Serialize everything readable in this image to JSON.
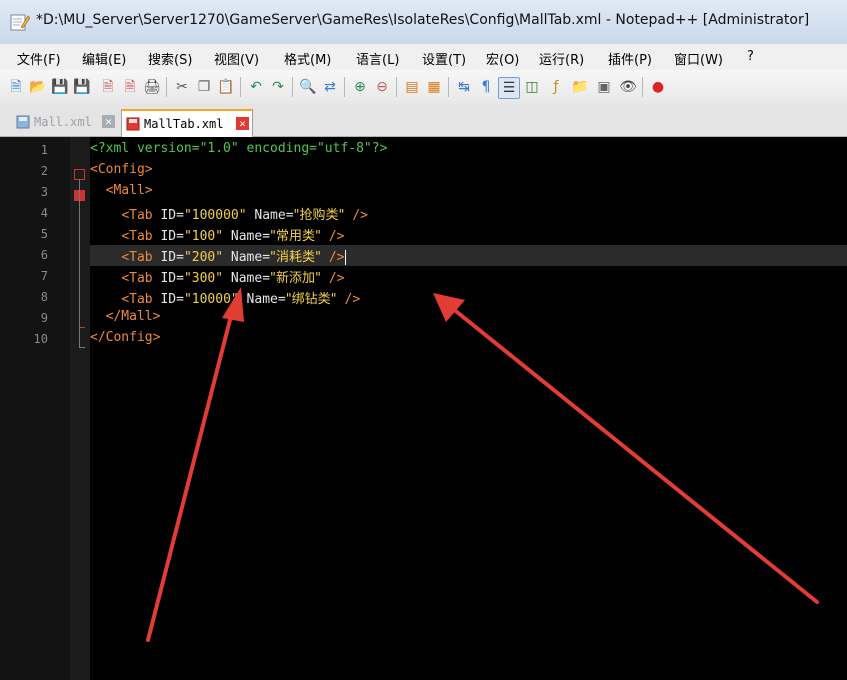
{
  "window": {
    "title": "*D:\\MU_Server\\Server1270\\GameServer\\GameRes\\IsolateRes\\Config\\MallTab.xml - Notepad++ [Administrator]"
  },
  "menu": [
    "文件(F)",
    "编辑(E)",
    "搜索(S)",
    "视图(V)",
    "格式(M)",
    "语言(L)",
    "设置(T)",
    "宏(O)",
    "运行(R)",
    "插件(P)",
    "窗口(W)",
    "?"
  ],
  "tabs": [
    {
      "label": "Mall.xml"
    },
    {
      "label": "MallTab.xml"
    }
  ],
  "line_numbers": [
    "1",
    "2",
    "3",
    "4",
    "5",
    "6",
    "7",
    "8",
    "9",
    "10"
  ],
  "code": {
    "l1": "<?xml version=\"1.0\" encoding=\"utf-8\"?>",
    "l2": "<Config>",
    "l3": "<Mall>",
    "tab_open": "<Tab",
    "id_attr": " ID=",
    "name_attr": " Name=",
    "tab_close": " />",
    "l9": "</Mall>",
    "l10": "</Config>",
    "rows": [
      {
        "id": "\"100000\"",
        "name": "\"抢购类\""
      },
      {
        "id": "\"100\"",
        "name": "\"常用类\""
      },
      {
        "id": "\"200\"",
        "name": "\"消耗类\""
      },
      {
        "id": "\"300\"",
        "name": "\"新添加\""
      },
      {
        "id": "\"10000\"",
        "name": "\"绑钻类\""
      }
    ]
  },
  "colors": {
    "tag": "#f08a3c",
    "attr": "#e6e6e6",
    "value": "#f2d04a",
    "pi": "#4ec94e",
    "annotation_arrow": "#e23c34"
  },
  "toolbar_icons": [
    "new-file-icon",
    "open-file-icon",
    "save-icon",
    "save-all-icon",
    "close-icon",
    "close-all-icon",
    "print-icon",
    "cut-icon",
    "copy-icon",
    "paste-icon",
    "undo-icon",
    "redo-icon",
    "find-icon",
    "replace-icon",
    "zoom-in-icon",
    "zoom-out-icon",
    "sync-v-icon",
    "sync-h-icon",
    "word-wrap-icon",
    "show-all-chars-icon",
    "indent-guide-icon",
    "doc-map-icon",
    "function-list-icon",
    "folder-workspace-icon",
    "monitor-icon",
    "eye-icon",
    "record-macro-icon"
  ]
}
